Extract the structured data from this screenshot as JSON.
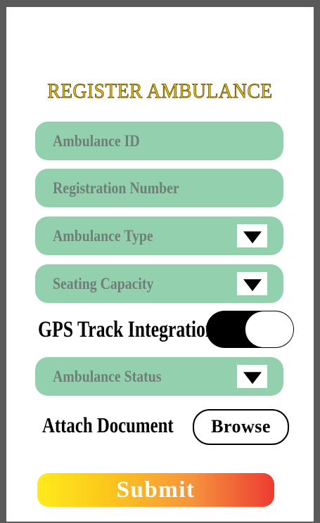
{
  "title": "REGISTER AMBULANCE",
  "fields": {
    "ambulance_id": "Ambulance ID",
    "registration_number": "Registration Number",
    "ambulance_type": "Ambulance Type",
    "seating_capacity": "Seating Capacity",
    "ambulance_status": "Ambulance Status"
  },
  "gps": {
    "label": "GPS Track Integration",
    "enabled": true
  },
  "attach": {
    "label": "Attach Document",
    "browse_label": "Browse"
  },
  "submit_label": "Submit",
  "colors": {
    "field_bg": "#92d0ae",
    "title": "#e6c21a",
    "submit_gradient": [
      "#ffea1c",
      "#fcc61c",
      "#f6943c",
      "#ee3b32"
    ]
  },
  "icons": {
    "dropdown": "caret-down-icon"
  }
}
